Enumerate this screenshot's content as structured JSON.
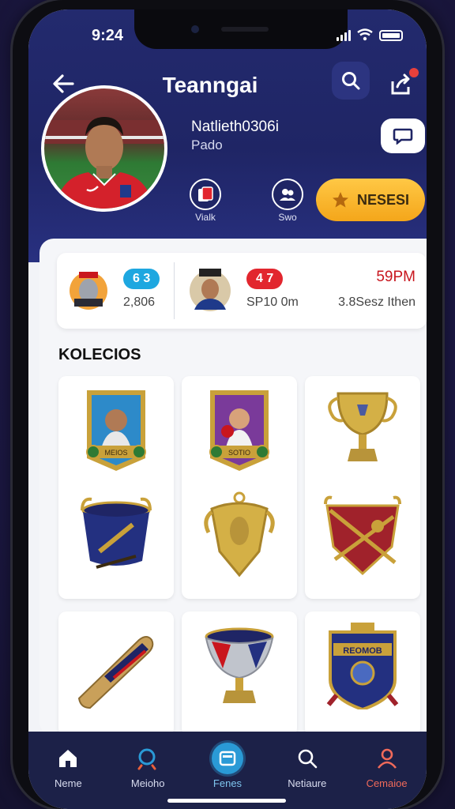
{
  "status": {
    "time": "9:24"
  },
  "header": {
    "title": "Teanngai"
  },
  "profile": {
    "username": "Natlieth0306i",
    "role": "Pado",
    "mini_badges": [
      {
        "label": "Vialk"
      },
      {
        "label": "Swo"
      }
    ],
    "follow_label": "NESESI"
  },
  "stats": [
    {
      "pill": "6 3",
      "pill_color": "#1ea7e0",
      "sub": "2,806"
    },
    {
      "pill": "4 7",
      "pill_color": "#e2262e",
      "sub": "SP10 0m"
    },
    {
      "value": "59PM",
      "value_color": "#c8161e",
      "sub": "3.8Sesz Ithen"
    }
  ],
  "collection": {
    "title": "KOLECIOS",
    "items": [
      {
        "icon": "player-card-icon",
        "banner": "MEIOS"
      },
      {
        "icon": "boxer-card-icon",
        "banner": "SOTIO"
      },
      {
        "icon": "gold-cup-icon"
      },
      {
        "icon": "blue-bucket-icon"
      },
      {
        "icon": "gold-shield-icon"
      },
      {
        "icon": "red-banner-shield-icon"
      },
      {
        "icon": "wooden-bat-icon"
      },
      {
        "icon": "silver-chalice-icon"
      },
      {
        "icon": "blue-crest-icon",
        "banner": "REOMOB"
      }
    ]
  },
  "nav": [
    {
      "label": "Neme",
      "icon": "home-icon",
      "color": "#d8dcef"
    },
    {
      "label": "Meioho",
      "icon": "search-ring-icon",
      "color": "#d8dcef"
    },
    {
      "label": "Fenes",
      "icon": "collection-icon",
      "color": "#7fc6ef",
      "active": true
    },
    {
      "label": "Netiaure",
      "icon": "search-icon",
      "color": "#d8dcef"
    },
    {
      "label": "Cemaioe",
      "icon": "profile-icon",
      "color": "#f06a5a"
    }
  ],
  "colors": {
    "accent": "#f4a61a",
    "header": "#232a6e",
    "nav_bg": "#1c2148"
  }
}
